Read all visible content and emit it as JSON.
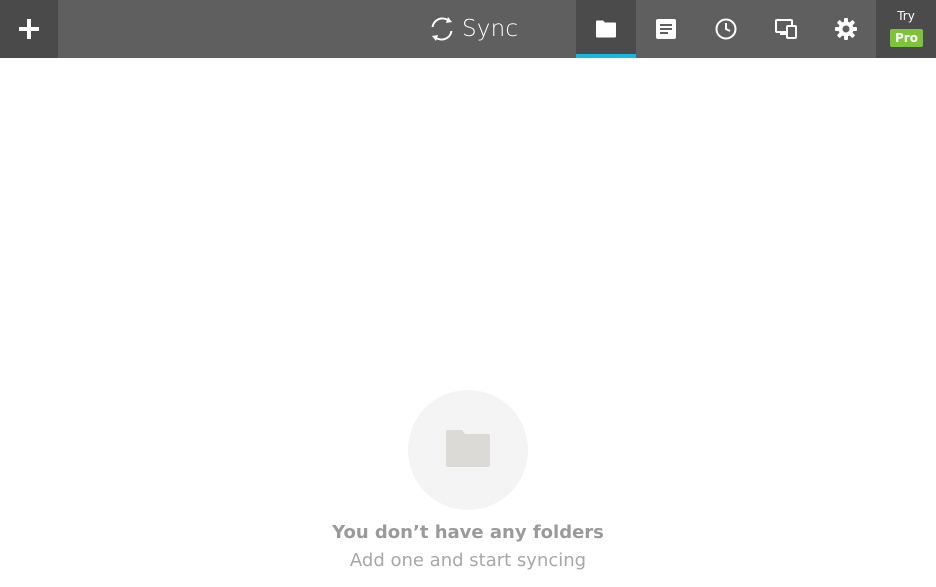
{
  "header": {
    "add_button_icon": "plus-icon",
    "brand": {
      "name": "Sync",
      "icon": "sync-arrows-icon"
    },
    "nav": [
      {
        "id": "folders",
        "icon": "folder-icon",
        "active": true
      },
      {
        "id": "transfers",
        "icon": "document-icon",
        "active": false
      },
      {
        "id": "history",
        "icon": "clock-icon",
        "active": false
      },
      {
        "id": "devices",
        "icon": "devices-icon",
        "active": false
      },
      {
        "id": "settings",
        "icon": "gear-icon",
        "active": false
      }
    ],
    "try_pro": {
      "try_label": "Try",
      "pro_label": "Pro"
    }
  },
  "empty_state": {
    "icon": "folder-icon",
    "title": "You don’t have any folders",
    "subtitle": "Add one and start syncing"
  },
  "colors": {
    "topbar": "#5f5f5f",
    "active_tab": "#4b4b4b",
    "accent": "#15b9e6",
    "pro_badge": "#7dc43b"
  }
}
